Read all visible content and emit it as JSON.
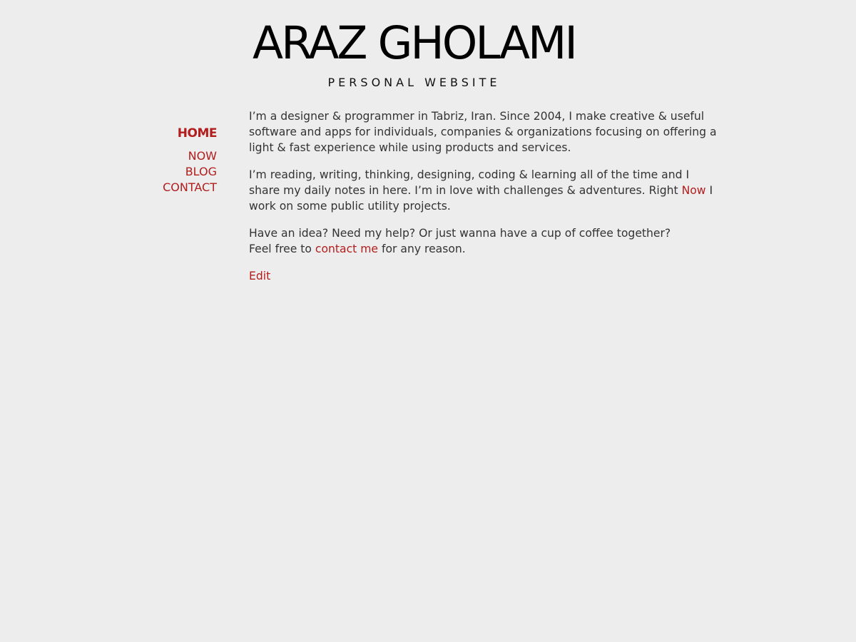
{
  "header": {
    "title": "ARAZ GHOLAMI",
    "subtitle": "PERSONAL WEBSITE"
  },
  "nav": {
    "items": [
      {
        "label": "HOME",
        "active": true
      },
      {
        "label": "NOW"
      },
      {
        "label": "BLOG"
      },
      {
        "label": "CONTACT"
      }
    ]
  },
  "content": {
    "p1": "I’m a designer & programmer in Tabriz, Iran. Since 2004, I make creative & useful software and apps for individuals, companies & organizations focusing on offering a light & fast experience while using products and services.",
    "p2_before": "I’m reading, writing, thinking, designing, coding & learning all of the time and I share my daily notes in here. I’m in love with challenges & adventures. Right ",
    "p2_link": "Now",
    "p2_after": " I work on some public utility projects.",
    "p3_line1": "Have an idea? Need my help? Or just wanna have a cup of coffee together?",
    "p3_before": "Feel free to ",
    "p3_link": "contact me",
    "p3_after": " for any reason.",
    "edit_label": "Edit"
  },
  "colors": {
    "background": "#ededed",
    "accent": "#b21d1d",
    "text": "#333333"
  }
}
